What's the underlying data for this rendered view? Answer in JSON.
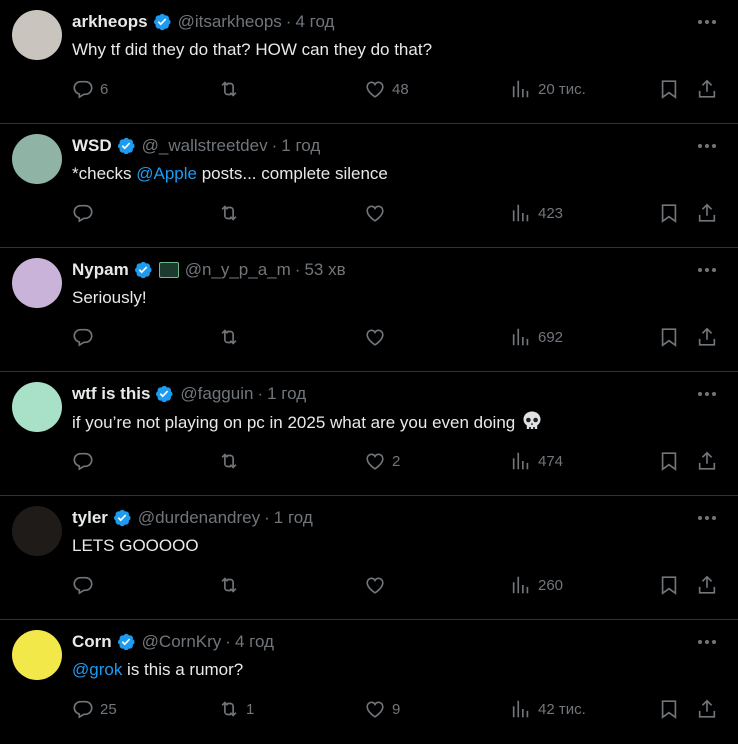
{
  "replies": [
    {
      "name": "arkheops",
      "handle": "@itsarkheops",
      "time": "4 год",
      "text_parts": [
        {
          "t": "Why tf did they do that? HOW can they do that?",
          "m": false
        }
      ],
      "replies": "6",
      "reposts": "",
      "likes": "48",
      "views": "20 тис.",
      "avatar_color": "#c9c4bd"
    },
    {
      "name": "WSD",
      "handle": "@_wallstreetdev",
      "time": "1 год",
      "text_parts": [
        {
          "t": "*checks ",
          "m": false
        },
        {
          "t": "@Apple",
          "m": true
        },
        {
          "t": " posts... complete silence",
          "m": false
        }
      ],
      "replies": "",
      "reposts": "",
      "likes": "",
      "views": "423",
      "avatar_color": "#8fb3a4"
    },
    {
      "name": "Nypam",
      "handle": "@n_y_p_a_m",
      "time": "53 хв",
      "text_parts": [
        {
          "t": "Seriously!",
          "m": false
        }
      ],
      "replies": "",
      "reposts": "",
      "likes": "",
      "views": "692",
      "avatar_color": "#c9b3d8"
    },
    {
      "name": "wtf is this",
      "handle": "@fagguin",
      "time": "1 год",
      "text_parts": [
        {
          "t": "if you’re not playing on pc in 2025 what are you even doing",
          "m": false
        }
      ],
      "replies": "",
      "reposts": "",
      "likes": "2",
      "views": "474",
      "avatar_color": "#a8e1c8"
    },
    {
      "name": "tyler",
      "handle": "@durdenandrey",
      "time": "1 год",
      "text_parts": [
        {
          "t": "LETS GOOOOO",
          "m": false
        }
      ],
      "replies": "",
      "reposts": "",
      "likes": "",
      "views": "260",
      "avatar_color": "#1e1b19"
    },
    {
      "name": "Corn",
      "handle": "@CornKry",
      "time": "4 год",
      "text_parts": [
        {
          "t": "@grok",
          "m": true
        },
        {
          "t": " is this a rumor?",
          "m": false
        }
      ],
      "replies": "25",
      "reposts": "1",
      "likes": "9",
      "views": "42 тис.",
      "avatar_color": "#f3e84a"
    }
  ],
  "colors": {
    "accent": "#1d9bf0",
    "muted": "#71767b",
    "text": "#e7e9ea",
    "border": "#2f3336"
  },
  "icons": [
    "reply-icon",
    "repost-icon",
    "like-icon",
    "views-icon",
    "bookmark-icon",
    "share-icon",
    "more-icon",
    "verified-badge-icon",
    "skull-emoji"
  ]
}
